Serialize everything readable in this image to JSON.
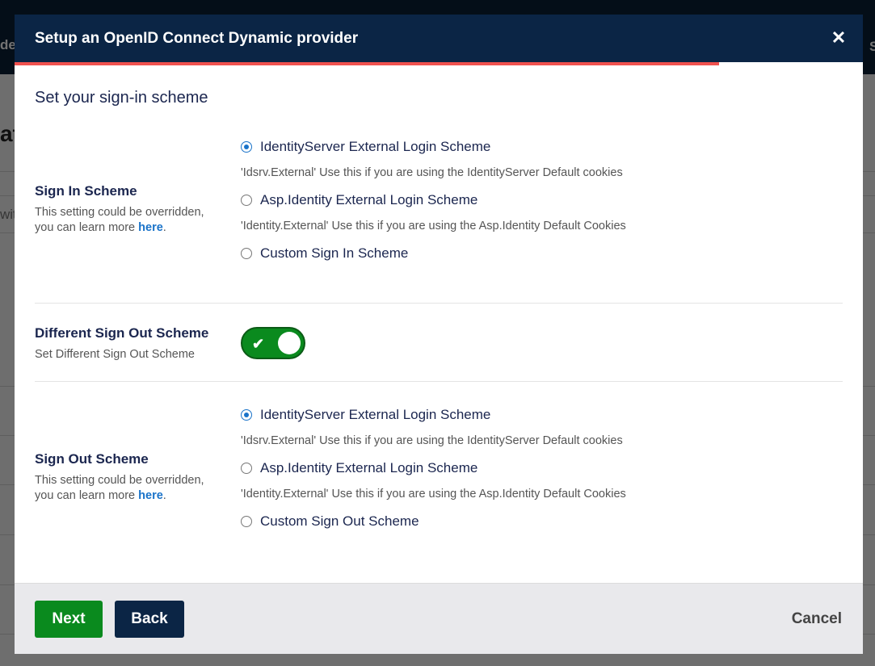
{
  "background": {
    "header_fragment_left": "des",
    "header_fragment_right": "S",
    "title_fragment": "at",
    "search_fragment": "wit"
  },
  "modal": {
    "title": "Setup an OpenID Connect Dynamic provider",
    "close_symbol": "✕",
    "progress_percent": 83,
    "section_title": "Set your sign-in scheme",
    "sign_in": {
      "label": "Sign In Scheme",
      "desc_prefix": "This setting could be overridden, you can learn more ",
      "link_text": "here",
      "desc_suffix": ".",
      "options": [
        {
          "label": "IdentityServer External Login Scheme",
          "help": "'Idsrv.External' Use this if you are using the IdentityServer Default cookies",
          "checked": true
        },
        {
          "label": "Asp.Identity External Login Scheme",
          "help": "'Identity.External' Use this if you are using the Asp.Identity Default Cookies",
          "checked": false
        },
        {
          "label": "Custom Sign In Scheme",
          "checked": false
        }
      ]
    },
    "different_sign_out": {
      "label": "Different Sign Out Scheme",
      "desc": "Set Different Sign Out Scheme",
      "enabled": true,
      "check_symbol": "✔"
    },
    "sign_out": {
      "label": "Sign Out Scheme",
      "desc_prefix": "This setting could be overridden, you can learn more ",
      "link_text": "here",
      "desc_suffix": ".",
      "options": [
        {
          "label": "IdentityServer External Login Scheme",
          "help": "'Idsrv.External' Use this if you are using the IdentityServer Default cookies",
          "checked": true
        },
        {
          "label": "Asp.Identity External Login Scheme",
          "help": "'Identity.External' Use this if you are using the Asp.Identity Default Cookies",
          "checked": false
        },
        {
          "label": "Custom Sign Out Scheme",
          "checked": false
        }
      ]
    },
    "footer": {
      "next_label": "Next",
      "back_label": "Back",
      "cancel_label": "Cancel"
    }
  },
  "colors": {
    "header_bg": "#0b2545",
    "accent_green": "#0a8a1e",
    "progress_red": "#f0514e",
    "link_blue": "#1a73c9"
  }
}
